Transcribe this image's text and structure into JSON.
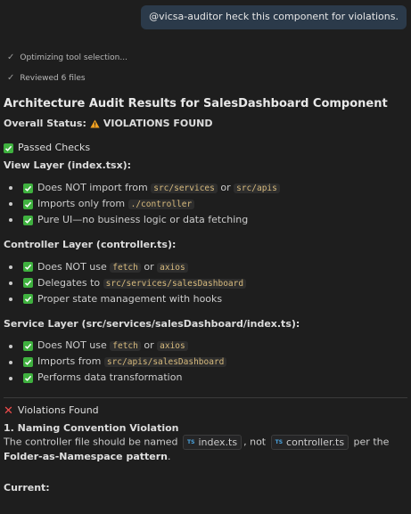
{
  "user_message": {
    "mention": "@vicsa-auditor",
    "text": " heck this component for violations."
  },
  "steps": [
    {
      "icon": "check-icon",
      "label": "Optimizing tool selection..."
    },
    {
      "icon": "check-icon",
      "label": "Reviewed 6 files"
    }
  ],
  "title": "Architecture Audit Results for SalesDashboard Component",
  "status": {
    "label": "Overall Status:",
    "icon": "warning-icon",
    "value": "VIOLATIONS FOUND"
  },
  "passed": {
    "icon": "checkbox-icon",
    "heading": "Passed Checks",
    "sections": [
      {
        "title": "View Layer (index.tsx):",
        "items": [
          {
            "pre": "Does NOT import from ",
            "code1": "src/services",
            "mid": " or ",
            "code2": "src/apis",
            "post": ""
          },
          {
            "pre": "Imports only from ",
            "code1": "./controller",
            "mid": "",
            "code2": "",
            "post": ""
          },
          {
            "pre": "Pure UI—no business logic or data fetching",
            "code1": "",
            "mid": "",
            "code2": "",
            "post": ""
          }
        ]
      },
      {
        "title": "Controller Layer (controller.ts):",
        "items": [
          {
            "pre": "Does NOT use ",
            "code1": "fetch",
            "mid": " or ",
            "code2": "axios",
            "post": ""
          },
          {
            "pre": "Delegates to ",
            "code1": "src/services/salesDashboard",
            "mid": "",
            "code2": "",
            "post": ""
          },
          {
            "pre": "Proper state management with hooks",
            "code1": "",
            "mid": "",
            "code2": "",
            "post": ""
          }
        ]
      },
      {
        "title": "Service Layer (src/services/salesDashboard/index.ts):",
        "items": [
          {
            "pre": "Does NOT use ",
            "code1": "fetch",
            "mid": " or ",
            "code2": "axios",
            "post": ""
          },
          {
            "pre": "Imports from ",
            "code1": "src/apis/salesDashboard",
            "mid": "",
            "code2": "",
            "post": ""
          },
          {
            "pre": "Performs data transformation",
            "code1": "",
            "mid": "",
            "code2": "",
            "post": ""
          }
        ]
      }
    ]
  },
  "violations": {
    "icon": "x-icon",
    "heading": "Violations Found",
    "item_title": "1. Naming Convention Violation",
    "text_before": "The controller file should be named ",
    "file1_badge": "TS",
    "file1": "index.ts",
    "text_mid": ", not ",
    "file2_badge": "TS",
    "file2": "controller.ts",
    "text_after": " per the ",
    "pattern": "Folder-as-Namespace pattern",
    "period": ".",
    "current_label": "Current:"
  }
}
